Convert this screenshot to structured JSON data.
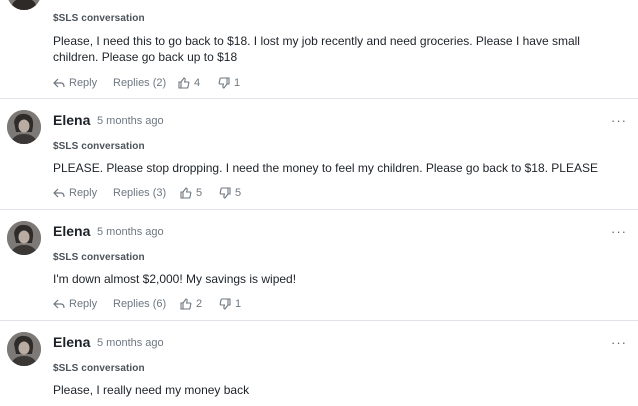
{
  "comments": [
    {
      "ticker": "$SLS conversation",
      "text": "Please, I need this to go back to $18. I lost my job recently and need groceries. Please I have small children. Please go back up to $18",
      "reply_label": "Reply",
      "replies_label": "Replies (2)",
      "likes": "4",
      "dislikes": "1"
    },
    {
      "name": "Elena",
      "time": "5 months ago",
      "more": "···",
      "ticker": "$SLS conversation",
      "text": "PLEASE. Please stop dropping. I need the money to feel my children. Please go back to $18. PLEASE",
      "reply_label": "Reply",
      "replies_label": "Replies (3)",
      "likes": "5",
      "dislikes": "5"
    },
    {
      "name": "Elena",
      "time": "5 months ago",
      "more": "···",
      "ticker": "$SLS conversation",
      "text": "I'm down almost $2,000! My savings is wiped!",
      "reply_label": "Reply",
      "replies_label": "Replies (6)",
      "likes": "2",
      "dislikes": "1"
    },
    {
      "name": "Elena",
      "time": "5 months ago",
      "more": "···",
      "ticker": "$SLS conversation",
      "text": "Please, I really need my money back"
    }
  ],
  "icons": {
    "reply": "reply-arrow-icon",
    "like": "thumbs-up-icon",
    "dislike": "thumbs-down-icon",
    "more": "more-dots-icon"
  },
  "colors": {
    "text": "#1d2228",
    "muted": "#6e7780",
    "divider": "#e0e4e9"
  }
}
